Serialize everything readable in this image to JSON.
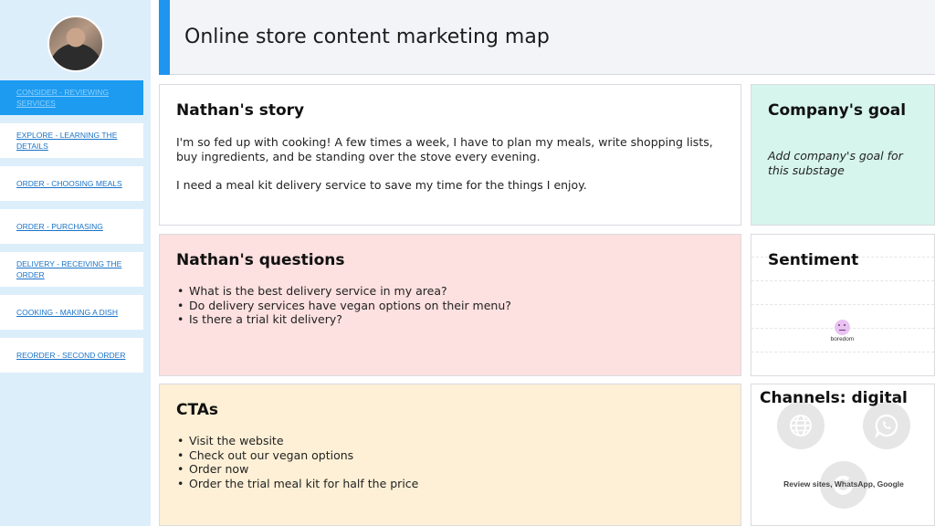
{
  "header": {
    "title": "Online store content marketing map"
  },
  "sidebar": {
    "items": [
      {
        "label": "CONSIDER - REVIEWING SERVICES",
        "active": true
      },
      {
        "label": "EXPLORE - LEARNING THE DETAILS"
      },
      {
        "label": "ORDER - CHOOSING MEALS"
      },
      {
        "label": "ORDER - PURCHASING"
      },
      {
        "label": "DELIVERY - RECEIVING THE ORDER"
      },
      {
        "label": "COOKING - MAKING A DISH"
      },
      {
        "label": "REORDER - SECOND ORDER"
      }
    ]
  },
  "story": {
    "title": "Nathan's story",
    "paragraph1": "I'm so fed up with cooking! A few times a week, I have to plan my meals, write shopping lists, buy ingredients, and be standing over the stove every evening.",
    "paragraph2": "I need a meal kit delivery service to save my time for the things I enjoy."
  },
  "goal": {
    "title": "Company's goal",
    "placeholder": "Add company's goal for this substage"
  },
  "questions": {
    "title": "Nathan's questions",
    "items": [
      "What is the best delivery service in my area?",
      "Do delivery services have vegan options on their menu?",
      "Is there a trial kit delivery?"
    ]
  },
  "sentiment": {
    "title": "Sentiment",
    "emotion": "boredom"
  },
  "ctas": {
    "title": "CTAs",
    "items": [
      "Visit the website",
      "Check out our vegan options",
      "Order now",
      "Order the trial meal kit for half the price"
    ]
  },
  "channels": {
    "title": "Channels: digital",
    "caption": "Review sites, WhatsApp, Google",
    "icons": [
      "globe-icon",
      "whatsapp-icon",
      "google-icon"
    ]
  },
  "colors": {
    "accent": "#1e95ee",
    "sidebar_bg": "#ddeefb",
    "goal_bg": "#d6f5ec",
    "questions_bg": "#fde0e0",
    "ctas_bg": "#fef0d6"
  }
}
